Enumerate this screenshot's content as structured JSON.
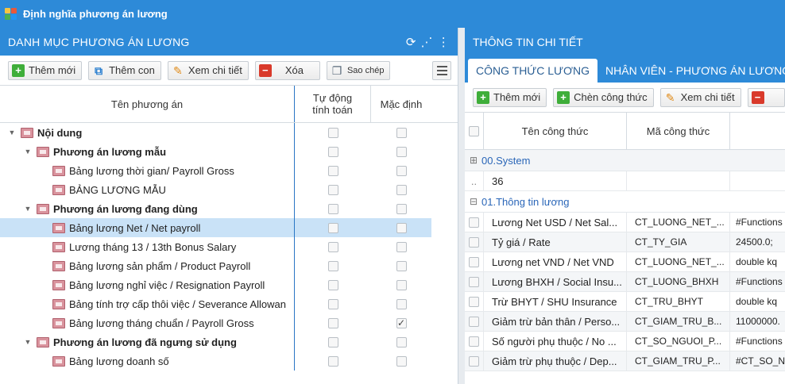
{
  "window": {
    "title": "Định nghĩa phương án lương"
  },
  "left": {
    "header": "DANH MỤC PHƯƠNG ÁN LƯƠNG",
    "toolbar": {
      "add": "Thêm mới",
      "add_child": "Thêm con",
      "view": "Xem chi tiết",
      "delete": "Xóa",
      "copy": "Sao chép"
    },
    "columns": {
      "name": "Tên phương án",
      "auto": "Tự động\ntính toán",
      "default": "Mặc định"
    },
    "rows": [
      {
        "label": "Nội dung",
        "level": 0,
        "group": true,
        "auto": false,
        "def": false
      },
      {
        "label": "Phương án lương mẫu",
        "level": 1,
        "group": true,
        "auto": false,
        "def": false
      },
      {
        "label": "Bảng lương thời gian/ Payroll Gross",
        "level": 2,
        "group": false,
        "auto": false,
        "def": false
      },
      {
        "label": "BẢNG LƯƠNG MẪU",
        "level": 2,
        "group": false,
        "auto": false,
        "def": false
      },
      {
        "label": "Phương án lương đang dùng",
        "level": 1,
        "group": true,
        "auto": false,
        "def": false
      },
      {
        "label": "Bảng lương Net / Net payroll",
        "level": 2,
        "group": false,
        "auto": false,
        "def": false,
        "selected": true
      },
      {
        "label": "Lương tháng 13 / 13th Bonus Salary",
        "level": 2,
        "group": false,
        "auto": false,
        "def": false
      },
      {
        "label": "Bảng lương sản phẩm / Product Payroll",
        "level": 2,
        "group": false,
        "auto": false,
        "def": false
      },
      {
        "label": "Bảng lương nghỉ việc / Resignation Payroll",
        "level": 2,
        "group": false,
        "auto": false,
        "def": false
      },
      {
        "label": "Bảng tính trợ cấp thôi việc / Severance Allowan",
        "level": 2,
        "group": false,
        "auto": false,
        "def": false
      },
      {
        "label": "Bảng lương tháng chuẩn / Payroll Gross",
        "level": 2,
        "group": false,
        "auto": false,
        "def": true
      },
      {
        "label": "Phương án lương đã ngưng sử dụng",
        "level": 1,
        "group": true,
        "auto": false,
        "def": false
      },
      {
        "label": "Bảng lương doanh số",
        "level": 2,
        "group": false,
        "auto": false,
        "def": false
      }
    ]
  },
  "right": {
    "header": "THÔNG TIN CHI TIẾT",
    "tabs": [
      "CÔNG THỨC LƯƠNG",
      "NHÂN VIÊN - PHƯƠNG ÁN LƯƠNG"
    ],
    "toolbar": {
      "add": "Thêm mới",
      "add_formula": "Chèn công thức",
      "view": "Xem chi tiết"
    },
    "columns": {
      "name": "Tên công thức",
      "code": "Mã công thức"
    },
    "group_system": "00.System",
    "system_row": {
      "dots": "..",
      "value": "36"
    },
    "group_info": "01.Thông tin lương",
    "rows": [
      {
        "name": "Lương Net USD / Net Sal...",
        "code": "CT_LUONG_NET_...",
        "value": "#Functions"
      },
      {
        "name": "Tỷ giá / Rate",
        "code": "CT_TY_GIA",
        "value": "24500.0;"
      },
      {
        "name": "Lương net VND / Net VND",
        "code": "CT_LUONG_NET_...",
        "value": "double kq"
      },
      {
        "name": "Lương BHXH / Social Insu...",
        "code": "CT_LUONG_BHXH",
        "value": "#Functions"
      },
      {
        "name": "Trừ BHYT / SHU Insurance",
        "code": "CT_TRU_BHYT",
        "value": "double kq"
      },
      {
        "name": "Giảm trừ bản thân / Perso...",
        "code": "CT_GIAM_TRU_B...",
        "value": "11000000."
      },
      {
        "name": "Số người phụ thuộc / No ...",
        "code": "CT_SO_NGUOI_P...",
        "value": "#Functions"
      },
      {
        "name": "Giảm trừ phụ thuộc / Dep...",
        "code": "CT_GIAM_TRU_P...",
        "value": "#CT_SO_N"
      }
    ]
  },
  "colors": {
    "header_blue": "#2d8ad8",
    "selected_row": "#c9e2f7",
    "group_text": "#2a66b8"
  }
}
